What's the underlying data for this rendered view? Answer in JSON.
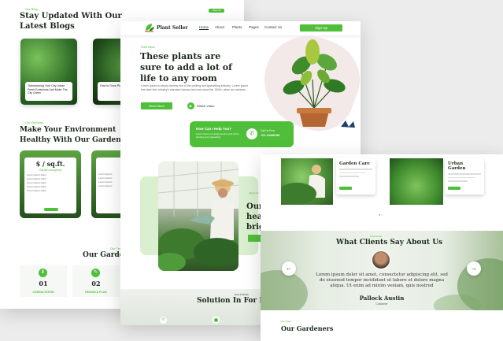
{
  "left_page": {
    "blog_tag": "Our Blog",
    "blog_heading": "Stay Updated With Our Latest Blogs",
    "view_all": "View All",
    "blogs": [
      {
        "title": "Transforming Your City Urban Fresh Emissions And Make The City Green"
      },
      {
        "title": "How to Grow Plants at Home"
      }
    ],
    "env_tag": "Our Services",
    "env_heading": "Make Your Environment Healthy With Our Gardeners",
    "pricing": [
      {
        "price": "$ / sq.ft.",
        "plan": "Garden Designing",
        "features": [
          "Lorem ipsum dolor",
          "Lorem ipsum dolor",
          "Lorem ipsum dolor",
          "Lorem ipsum dolor",
          "Lorem ipsum dolor"
        ]
      },
      {
        "price": "$",
        "plan": "",
        "features": [
          "Lorem ipsum",
          "Lorem ipsum",
          "Lorem ipsum",
          "Lorem ipsum"
        ]
      }
    ],
    "gardeners_tag": "Our Team",
    "gardeners_heading": "Our Gardeners",
    "steps": [
      {
        "num": "01",
        "label": "CONSULTATION"
      },
      {
        "num": "02",
        "label": "DESIGN & PLAN"
      }
    ]
  },
  "middle_page": {
    "brand": "Plant Seller",
    "nav": [
      "Home",
      "About",
      "Plants",
      "Pages",
      "Contact Us"
    ],
    "sign_up": "Sign Up",
    "hero_tag": "Plant Seller",
    "hero_heading": "These plants are sure to add a lot of life to any room",
    "hero_text": "Lorem Ipsum is simply dummy text of the printing and typesetting industry. Lorem Ipsum has been the industry's standard dummy text ever since the 1500s, when an unknown",
    "read_more": "Read More",
    "watch_video": "Watch Video",
    "help_title": "How Can I Help You?",
    "help_text": "Lorem Ipsum is simply dummy text of the printing and typesetting",
    "call_label": "Call Us Free",
    "call_number": "+01 23456789",
    "heal_tag": "About Us",
    "heal_heading": "Our heal brig",
    "solution_tag": "How It Works",
    "solution_heading": "Solution In For Eas"
  },
  "right_page": {
    "services": [
      {
        "title": "Garden Care"
      },
      {
        "title": "Urban Garden"
      }
    ],
    "testimonial_tag": "Testimonial",
    "testimonial_heading": "What Clients Say About Us",
    "quote": "Lorem ipsum dolor sit amet, consectetur adipiscing elit, sed do eiusmod tempor incididunt ut labore et dolore magna aliqua. Ut enim ad minim veniam, quis nostrud",
    "client_name": "Pallock Austin",
    "client_role": "Customer",
    "gardeners_tag": "Our Team",
    "gardeners_heading": "Our Gardeners"
  },
  "colors": {
    "accent": "#4fbf3a",
    "heading": "#1c2a1c"
  }
}
